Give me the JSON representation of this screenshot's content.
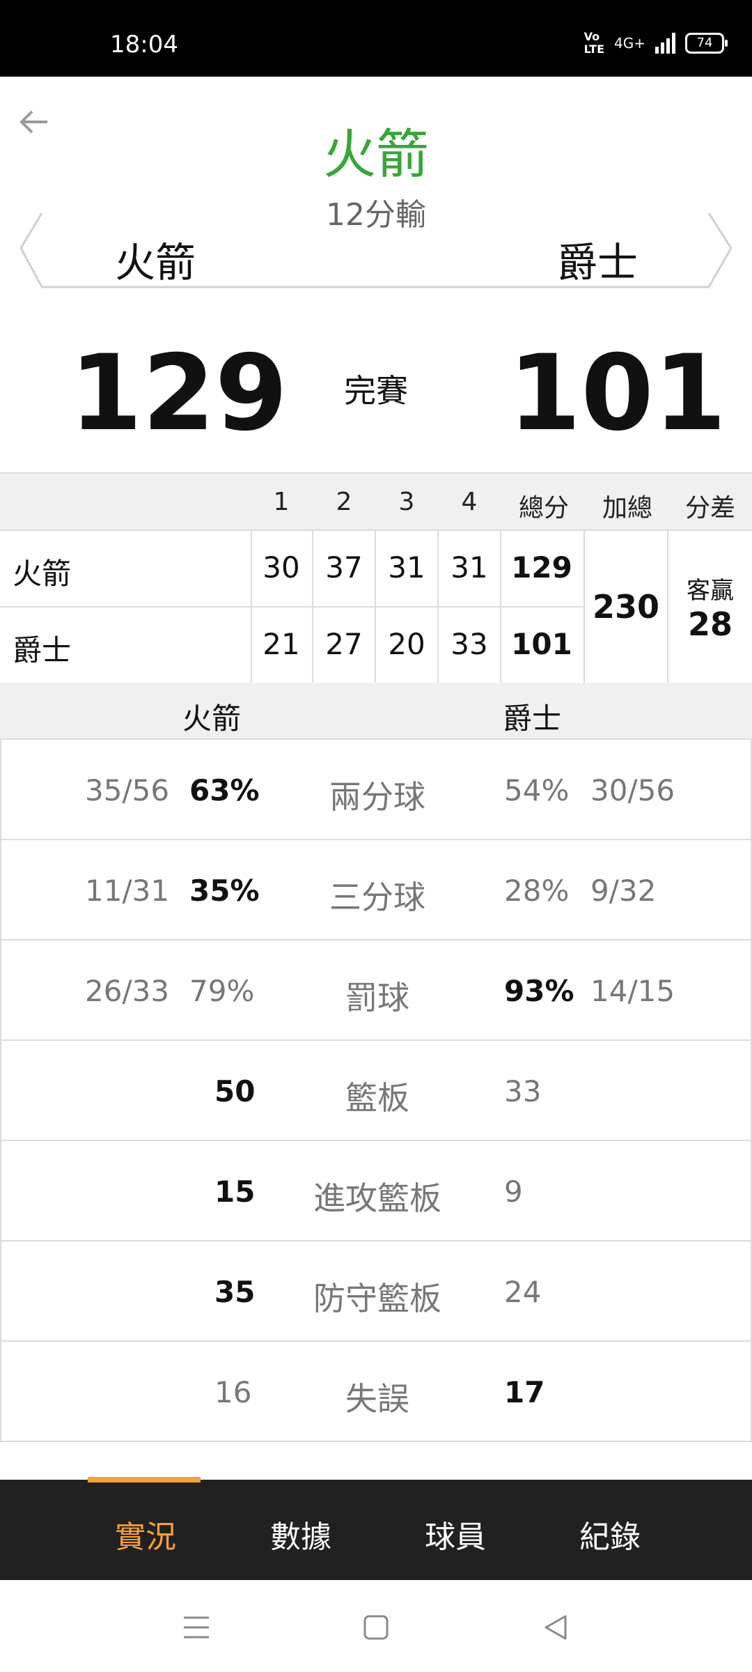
{
  "status_bar": {
    "time": "18:04",
    "volte_top": "Vo",
    "volte_bottom": "LTE",
    "network": "4G+",
    "battery": "74"
  },
  "header": {
    "winner": "火箭",
    "result": "12分輸",
    "home_team": "火箭",
    "away_team": "爵士"
  },
  "score": {
    "home": "129",
    "away": "101",
    "status": "完賽"
  },
  "quarters": {
    "headers": [
      "1",
      "2",
      "3",
      "4",
      "總分",
      "加總",
      "分差"
    ],
    "rows": [
      {
        "team": "火箭",
        "q": [
          "30",
          "37",
          "31",
          "31"
        ],
        "total": "129"
      },
      {
        "team": "爵士",
        "q": [
          "21",
          "27",
          "20",
          "33"
        ],
        "total": "101"
      }
    ],
    "combined": "230",
    "diff_label": "客贏",
    "diff_value": "28"
  },
  "team_stats": {
    "home_team": "火箭",
    "away_team": "爵士",
    "rows": [
      {
        "category": "兩分球",
        "home_frac": "35/56",
        "home_val": "63%",
        "away_val": "54%",
        "away_frac": "30/56",
        "bold": "home"
      },
      {
        "category": "三分球",
        "home_frac": "11/31",
        "home_val": "35%",
        "away_val": "28%",
        "away_frac": "9/32",
        "bold": "home"
      },
      {
        "category": "罰球",
        "home_frac": "26/33",
        "home_val": "79%",
        "away_val": "93%",
        "away_frac": "14/15",
        "bold": "away"
      },
      {
        "category": "籃板",
        "home_frac": "",
        "home_val": "50",
        "away_val": "33",
        "away_frac": "",
        "bold": "home"
      },
      {
        "category": "進攻籃板",
        "home_frac": "",
        "home_val": "15",
        "away_val": "9",
        "away_frac": "",
        "bold": "home"
      },
      {
        "category": "防守籃板",
        "home_frac": "",
        "home_val": "35",
        "away_val": "24",
        "away_frac": "",
        "bold": "home"
      },
      {
        "category": "失誤",
        "home_frac": "",
        "home_val": "16",
        "away_val": "17",
        "away_frac": "",
        "bold": "away"
      }
    ]
  },
  "tabs": [
    {
      "label": "實況",
      "active": true
    },
    {
      "label": "數據",
      "active": false
    },
    {
      "label": "球員",
      "active": false
    },
    {
      "label": "紀錄",
      "active": false
    }
  ],
  "colors": {
    "accent": "#f5a035",
    "winner": "#3aa53a",
    "tabbar": "#212121"
  }
}
